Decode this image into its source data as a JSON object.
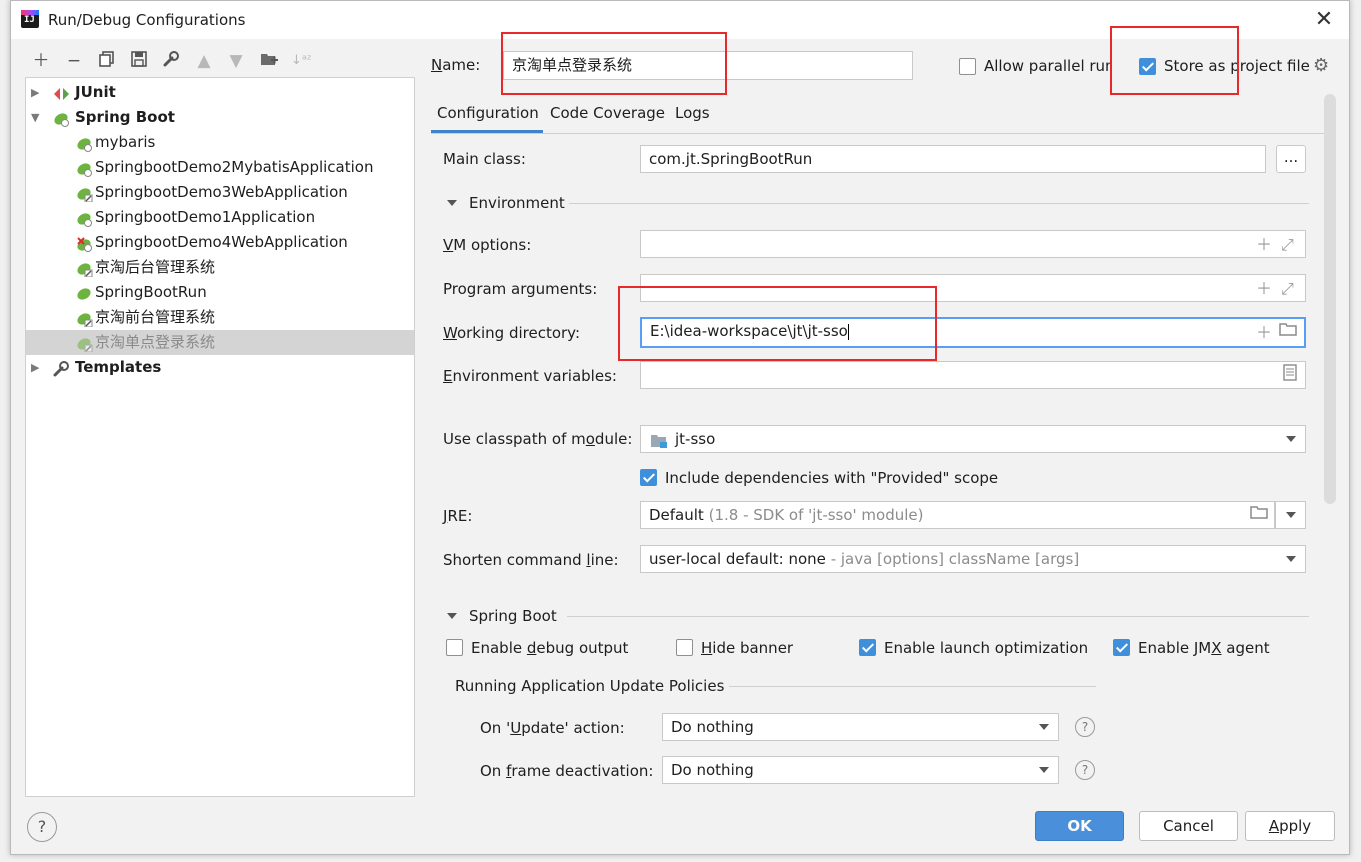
{
  "window": {
    "title": "Run/Debug Configurations"
  },
  "toolbar": {
    "icons": [
      "add-icon",
      "remove-icon",
      "copy-icon",
      "save-icon",
      "wrench-icon",
      "arrow-up-icon",
      "arrow-down-icon",
      "folder-add-icon",
      "sort-icon"
    ]
  },
  "tree": {
    "junit": "JUnit",
    "spring_boot": "Spring Boot",
    "items": [
      "mybaris",
      "SpringbootDemo2MybatisApplication",
      "SpringbootDemo3WebApplication",
      "SpringbootDemo1Application",
      "SpringbootDemo4WebApplication",
      "京淘后台管理系统",
      "SpringBootRun",
      "京淘前台管理系统",
      "京淘单点登录系统"
    ],
    "templates": "Templates"
  },
  "config": {
    "name_label": "Name:",
    "name_value": "京淘单点登录系统",
    "allow_parallel_label": "Allow parallel run",
    "allow_parallel_checked": false,
    "store_label": "Store as project file",
    "store_checked": true
  },
  "tabs": [
    "Configuration",
    "Code Coverage",
    "Logs"
  ],
  "form": {
    "main_class_label": "Main class:",
    "main_class_value": "com.jt.SpringBootRun",
    "browse_label": "...",
    "environment_section": "Environment",
    "vm_options_label": "VM options:",
    "vm_options_value": "",
    "program_args_label": "Program arguments:",
    "program_args_value": "",
    "working_dir_label": "Working directory:",
    "working_dir_value": "E:\\idea-workspace\\jt\\jt-sso",
    "env_vars_label": "Environment variables:",
    "env_vars_value": "",
    "classpath_label": "Use classpath of module:",
    "classpath_value": "jt-sso",
    "include_deps_label": "Include dependencies with \"Provided\" scope",
    "include_deps_checked": true,
    "jre_label": "JRE:",
    "jre_value": "Default",
    "jre_sub": "(1.8 - SDK of 'jt-sso' module)",
    "shorten_label": "Shorten command line:",
    "shorten_value": "user-local default: none",
    "shorten_sub": "- java [options] className [args]"
  },
  "spring_boot": {
    "section": "Spring Boot",
    "debug_output": "Enable debug output",
    "debug_output_checked": false,
    "hide_banner": "Hide banner",
    "hide_banner_checked": false,
    "launch_opt": "Enable launch optimization",
    "launch_opt_checked": true,
    "jmx": "Enable JMX agent",
    "jmx_checked": true,
    "policies_section": "Running Application Update Policies",
    "update_action_label": "On 'Update' action:",
    "update_action_value": "Do nothing",
    "frame_deact_label": "On frame deactivation:",
    "frame_deact_value": "Do nothing"
  },
  "footer": {
    "help": "?",
    "ok": "OK",
    "cancel": "Cancel",
    "apply": "Apply"
  },
  "colors": {
    "accent": "#4a8fd9",
    "selection": "#d4d4d4",
    "annotation_red": "#e8282b",
    "spring_green": "#6db33f"
  }
}
